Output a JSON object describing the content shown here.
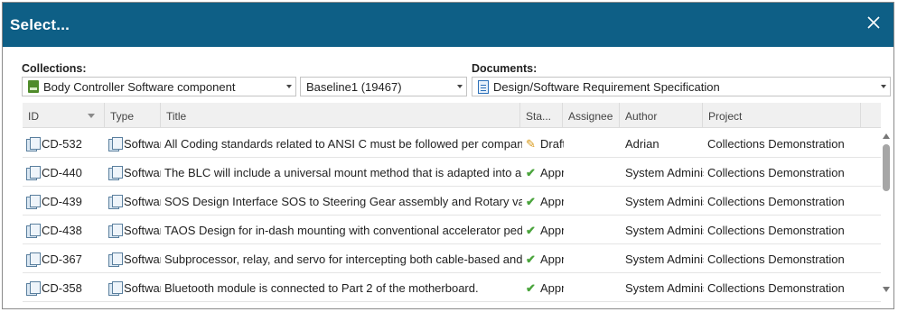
{
  "dialog": {
    "title": "Select...",
    "close_icon": "close-icon"
  },
  "collections": {
    "label": "Collections:",
    "collection_value": "Body Controller Software component",
    "baseline_value": "Baseline1 (19467)"
  },
  "documents": {
    "label": "Documents:",
    "document_value": "Design/Software Requirement Specification"
  },
  "table": {
    "columns": {
      "id": "ID",
      "type": "Type",
      "title": "Title",
      "status": "Sta...",
      "assignee": "Assignee",
      "author": "Author",
      "project": "Project"
    },
    "rows": [
      {
        "id": "CD-532",
        "type": "Software Requirement",
        "title": "All Coding standards related to ANSI C must be followed per company guidelines",
        "status": "Draft",
        "status_icon": "pencil-icon",
        "assignee": "",
        "author": "Adrian",
        "project": "Collections Demonstration"
      },
      {
        "id": "CD-440",
        "type": "Software Requirement",
        "title": "The BLC will include a universal mount method that is adapted into any model",
        "status": "Approved",
        "status_icon": "check-icon",
        "assignee": "",
        "author": "System Administrator",
        "project": "Collections Demonstration"
      },
      {
        "id": "CD-439",
        "type": "Software Requirement",
        "title": "SOS Design Interface SOS to Steering Gear assembly and Rotary value",
        "status": "Approved",
        "status_icon": "check-icon",
        "assignee": "",
        "author": "System Administrator",
        "project": "Collections Demonstration"
      },
      {
        "id": "CD-438",
        "type": "Software Requirement",
        "title": "TAOS Design for in-dash mounting with conventional accelerator pedal",
        "status": "Approved",
        "status_icon": "check-icon",
        "assignee": "",
        "author": "System Administrator",
        "project": "Collections Demonstration"
      },
      {
        "id": "CD-367",
        "type": "Software Requirement",
        "title": "Subprocessor, relay, and servo for intercepting both cable-based and wire-based",
        "status": "Approved",
        "status_icon": "check-icon",
        "assignee": "",
        "author": "System Administrator",
        "project": "Collections Demonstration"
      },
      {
        "id": "CD-358",
        "type": "Software Requirement",
        "title": "Bluetooth module is connected to Part 2 of the motherboard.",
        "status": "Approved",
        "status_icon": "check-icon",
        "assignee": "",
        "author": "System Administrator",
        "project": "Collections Demonstration"
      }
    ]
  },
  "colors": {
    "titlebar": "#0e5f86",
    "approved": "#4aa43c",
    "draft": "#d99a1a"
  }
}
